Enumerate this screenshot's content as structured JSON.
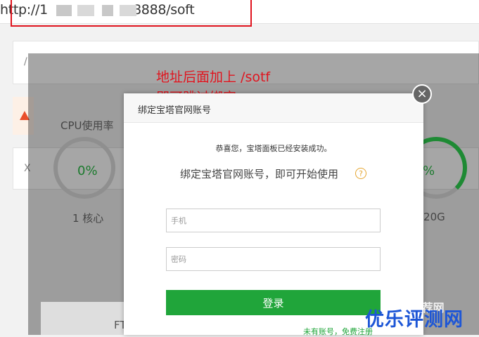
{
  "url": {
    "prefix": "http://1",
    "suffix": ":8888/soft"
  },
  "background": {
    "side_label_1": "/",
    "side_label_2": "X",
    "cpu_label": "CPU使用率",
    "cpu_value": "0%",
    "cpu_cores": "1 核心",
    "disk_value": "%",
    "disk_size": "/20G",
    "ftp_label": "FT"
  },
  "annotation": {
    "line1": "地址后面加上 /sotf",
    "line2": "即可跳过绑定~"
  },
  "modal": {
    "title": "绑定宝塔官网账号",
    "close_label": "×",
    "congrats": "恭喜您，宝塔面板已经安装成功。",
    "bind_title": "绑定宝塔官网账号，即可开始使用",
    "help_label": "?",
    "phone_placeholder": "手机",
    "password_placeholder": "密码",
    "login_label": "登录",
    "register_text": "未有账号，免费注册"
  },
  "watermark": {
    "top": "VPS推荐网",
    "main": "优乐评测网"
  },
  "colors": {
    "accent_green": "#20a53a",
    "annotation_red": "#e0141e",
    "watermark_blue": "#1d56d6"
  }
}
